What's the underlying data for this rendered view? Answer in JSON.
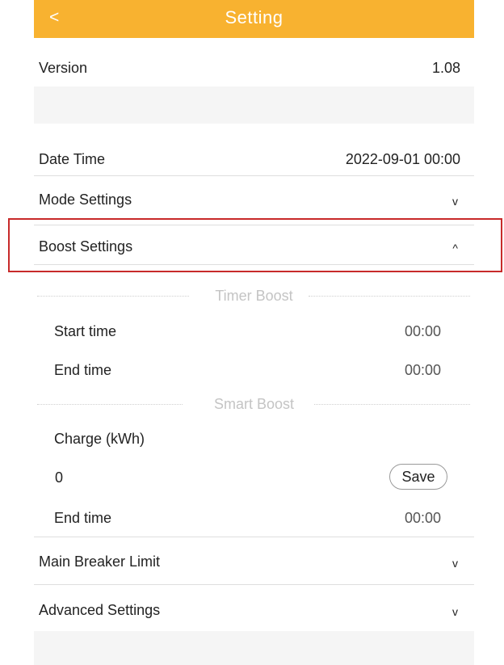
{
  "header": {
    "back_label": "<",
    "title": "Setting"
  },
  "version": {
    "label": "Version",
    "value": "1.08"
  },
  "date_time": {
    "label": "Date Time",
    "value": "2022-09-01 00:00"
  },
  "mode_settings": {
    "label": "Mode Settings",
    "chevron": "v"
  },
  "boost_settings": {
    "label": "Boost Settings",
    "chevron": "^",
    "timer_boost": {
      "title": "Timer Boost",
      "start_label": "Start time",
      "start_value": "00:00",
      "end_label": "End time",
      "end_value": "00:00"
    },
    "smart_boost": {
      "title": "Smart Boost",
      "charge_label": "Charge (kWh)",
      "charge_value": "0",
      "save_label": "Save",
      "end_label": "End time",
      "end_value": "00:00"
    }
  },
  "main_breaker": {
    "label": "Main Breaker Limit",
    "chevron": "v"
  },
  "advanced": {
    "label": "Advanced Settings",
    "chevron": "v"
  },
  "colors": {
    "accent": "#f8b230",
    "highlight": "#c82a2a"
  }
}
